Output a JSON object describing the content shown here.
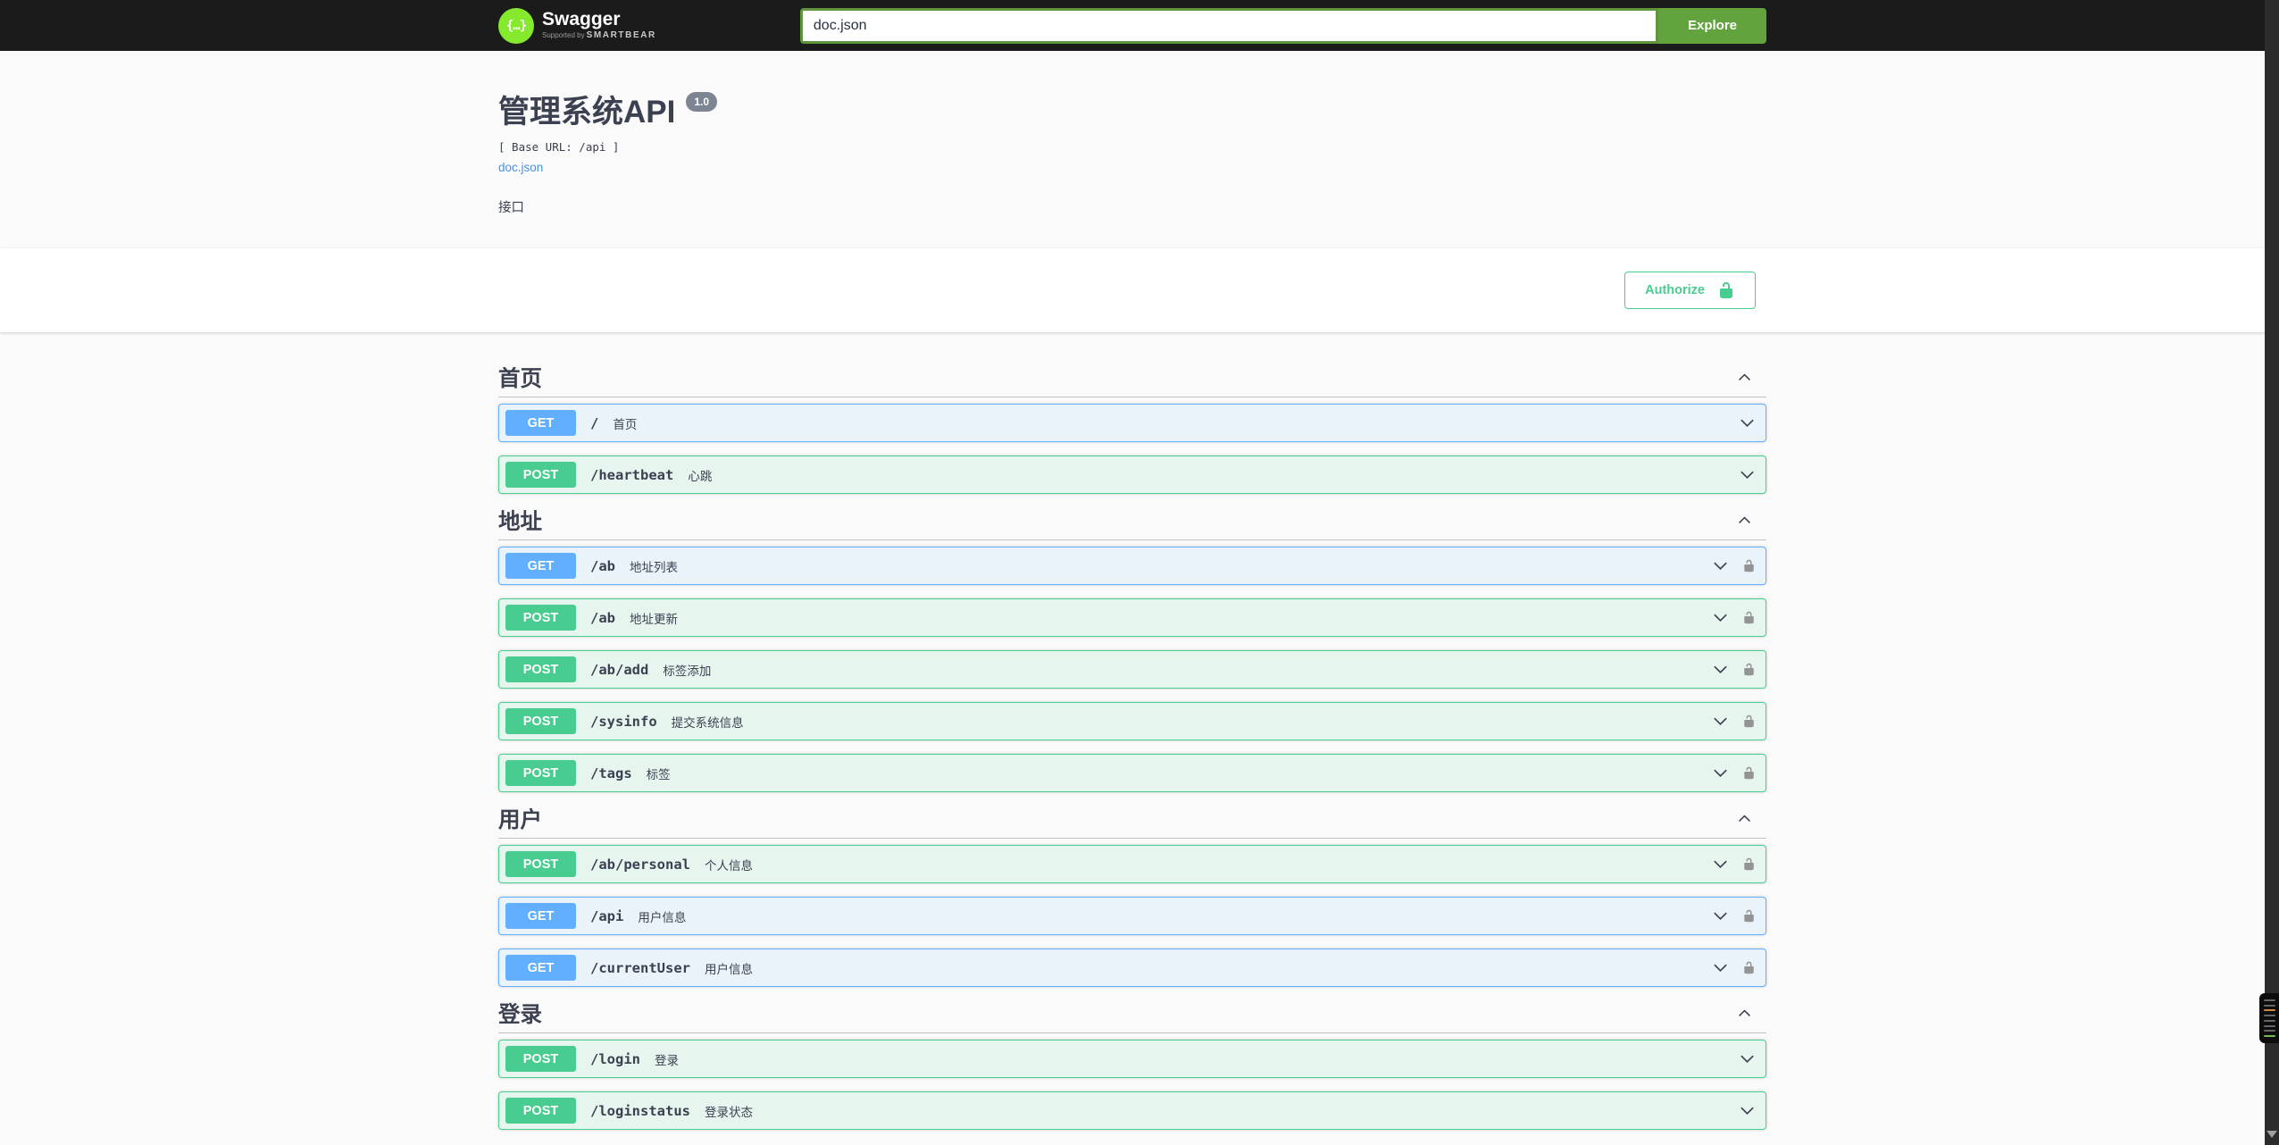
{
  "topbar": {
    "brand": "Swagger",
    "supported_by": "Supported by",
    "smartbear": "SMARTBEAR",
    "logo_braces": "{…}",
    "search_value": "doc.json",
    "explore_label": "Explore"
  },
  "info": {
    "title": "管理系统API",
    "version": "1.0",
    "base_url_label": "[ Base URL: /api ]",
    "doc_link": "doc.json",
    "description": "接口"
  },
  "auth": {
    "authorize_label": "Authorize"
  },
  "colors": {
    "topbar_bg": "#1b1b1b",
    "logo_green": "#85ea2d",
    "explore_green": "#62a33e",
    "get_blue": "#61affe",
    "post_green": "#49cc90",
    "authorize_green": "#49cc90",
    "text": "#3b4151",
    "link_blue": "#4990e2",
    "version_badge_grey": "#7d8492",
    "lock_grey": "#949494"
  },
  "sections": [
    {
      "name": "首页",
      "expanded": true,
      "endpoints": [
        {
          "method": "GET",
          "path": "/",
          "summary": "首页",
          "locked": false
        },
        {
          "method": "POST",
          "path": "/heartbeat",
          "summary": "心跳",
          "locked": false
        }
      ]
    },
    {
      "name": "地址",
      "expanded": true,
      "endpoints": [
        {
          "method": "GET",
          "path": "/ab",
          "summary": "地址列表",
          "locked": true
        },
        {
          "method": "POST",
          "path": "/ab",
          "summary": "地址更新",
          "locked": true
        },
        {
          "method": "POST",
          "path": "/ab/add",
          "summary": "标签添加",
          "locked": true
        },
        {
          "method": "POST",
          "path": "/sysinfo",
          "summary": "提交系统信息",
          "locked": true
        },
        {
          "method": "POST",
          "path": "/tags",
          "summary": "标签",
          "locked": true
        }
      ]
    },
    {
      "name": "用户",
      "expanded": true,
      "endpoints": [
        {
          "method": "POST",
          "path": "/ab/personal",
          "summary": "个人信息",
          "locked": true
        },
        {
          "method": "GET",
          "path": "/api",
          "summary": "用户信息",
          "locked": true
        },
        {
          "method": "GET",
          "path": "/currentUser",
          "summary": "用户信息",
          "locked": true
        }
      ]
    },
    {
      "name": "登录",
      "expanded": true,
      "endpoints": [
        {
          "method": "POST",
          "path": "/login",
          "summary": "登录",
          "locked": false
        },
        {
          "method": "POST",
          "path": "/loginstatus",
          "summary": "登录状态",
          "locked": false
        }
      ]
    }
  ],
  "scrollbar": {
    "minimap_lines": [
      "#686868",
      "#686868",
      "#cf8b3e",
      "#686868",
      "#686868",
      "#686868",
      "#686868",
      "#78b94e"
    ]
  }
}
